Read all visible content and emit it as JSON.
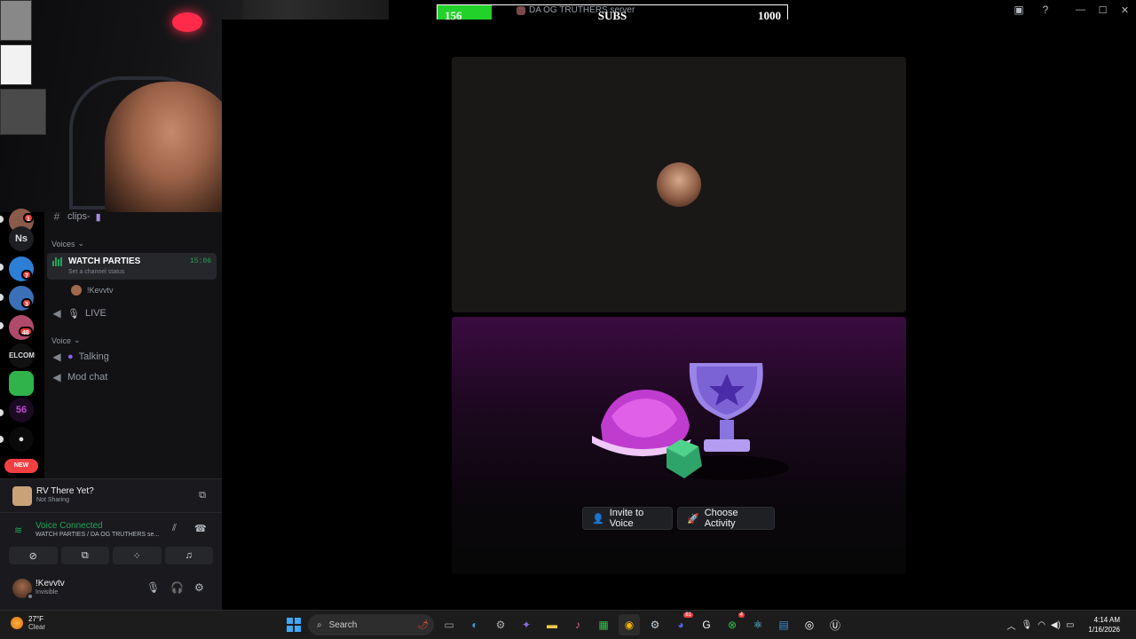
{
  "overlay": {
    "sub_goal": {
      "current": "156",
      "label": "SUBS",
      "goal": "1000",
      "progress": 0.156
    },
    "server_title_ghost": "DA OG TRUTHERS server"
  },
  "server_rail": {
    "badges": [
      "1",
      "7",
      "3",
      "48"
    ],
    "text_server": "Ns",
    "welcome_text": "ELCOM",
    "numeric_server": "56",
    "new_label": "NEW"
  },
  "channels": {
    "clips": "clips-",
    "category_voices": "Voices",
    "watch_parties": {
      "name": "WATCH PARTIES",
      "status": "Set a channel status",
      "timer": "15:06",
      "member": "!Kevvtv"
    },
    "live": "LIVE",
    "category_voice": "Voice",
    "talking": "Talking",
    "mod_chat": "Mod chat"
  },
  "activity_panel": {
    "title": "RV There Yet?",
    "subtitle": "Not Sharing"
  },
  "voice_panel": {
    "status": "Voice Connected",
    "location": "WATCH PARTIES / DA OG TRUTHERS se..."
  },
  "user_panel": {
    "username": "!Kevvtv",
    "status": "Invisible"
  },
  "stage": {
    "invite_label": "Invite to Voice",
    "choose_label": "Choose Activity"
  },
  "taskbar": {
    "weather_temp": "27°F",
    "weather_cond": "Clear",
    "search_placeholder": "Search",
    "time": "4:14 AM",
    "date": "1/16/2026",
    "steam_badge": "81",
    "discord_badge": "4"
  },
  "colors": {
    "green": "#23a55a",
    "red": "#f23f42",
    "subgoal_fill": "#22d12a"
  }
}
